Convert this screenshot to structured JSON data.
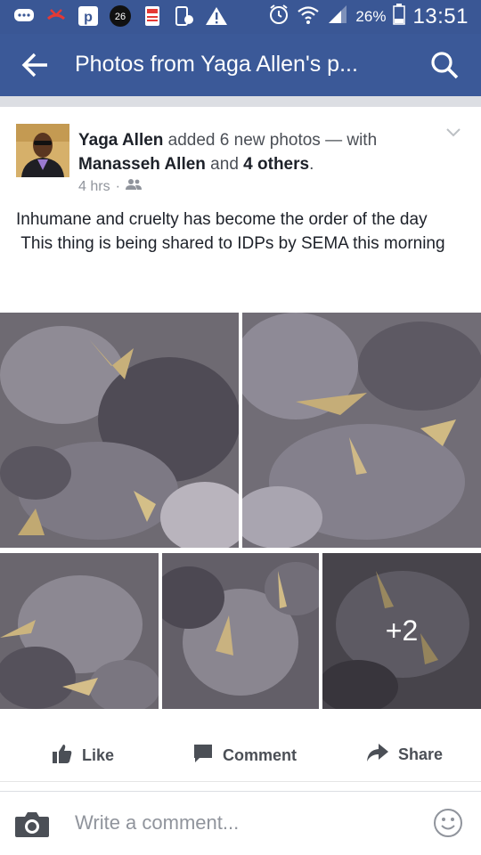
{
  "status_bar": {
    "badge_number": "26",
    "battery": "26%",
    "time": "13:51"
  },
  "app_bar": {
    "title": "Photos from Yaga Allen's p..."
  },
  "post": {
    "author": "Yaga Allen",
    "action_text": " added 6 new photos — with ",
    "tagged_name": "Manasseh Allen",
    "and_text": " and ",
    "others": "4 others",
    "period": ".",
    "time": "4 hrs",
    "body": "Inhumane and cruelty has become the order of the day\n This thing is being shared to IDPs by SEMA this morning",
    "more_photos": "+2"
  },
  "actions": {
    "like": "Like",
    "comment": "Comment",
    "share": "Share"
  },
  "comment_box": {
    "placeholder": "Write a comment..."
  }
}
